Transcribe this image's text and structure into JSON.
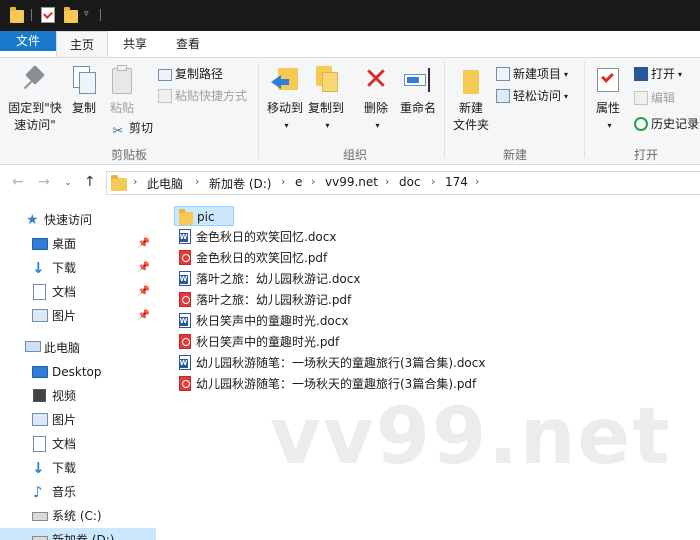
{
  "ribbon_tabs": {
    "file": "文件",
    "home": "主页",
    "share": "共享",
    "view": "查看"
  },
  "clipboard": {
    "pin_quick_access": "固定到\"快速访问\"",
    "copy": "复制",
    "paste": "粘贴",
    "copy_path": "复制路径",
    "paste_shortcut": "粘贴快捷方式",
    "cut": "剪切",
    "group_label": "剪贴板"
  },
  "organize": {
    "move_to": "移动到",
    "copy_to": "复制到",
    "delete": "删除",
    "rename": "重命名",
    "group_label": "组织"
  },
  "new_group": {
    "new_folder_line1": "新建",
    "new_folder_line2": "文件夹",
    "new_item": "新建项目",
    "easy_access": "轻松访问",
    "group_label": "新建"
  },
  "open_group": {
    "properties": "属性",
    "open": "打开",
    "edit": "编辑",
    "history": "历史记录",
    "group_label": "打开"
  },
  "breadcrumb": [
    "此电脑",
    "新加卷 (D:)",
    "e",
    "vv99.net",
    "doc",
    "174"
  ],
  "sidebar": {
    "quick_access": "快速访问",
    "quick_items": [
      "桌面",
      "下载",
      "文档",
      "图片"
    ],
    "this_pc": "此电脑",
    "pc_items": [
      "Desktop",
      "视频",
      "图片",
      "文档",
      "下载",
      "音乐",
      "系统 (C:)",
      "新加卷 (D:)"
    ]
  },
  "files": [
    {
      "name": "pic",
      "type": "folder"
    },
    {
      "name": "金色秋日的欢笑回忆.docx",
      "type": "docx"
    },
    {
      "name": "金色秋日的欢笑回忆.pdf",
      "type": "pdf"
    },
    {
      "name": "落叶之旅：幼儿园秋游记.docx",
      "type": "docx"
    },
    {
      "name": "落叶之旅：幼儿园秋游记.pdf",
      "type": "pdf"
    },
    {
      "name": "秋日笑声中的童趣时光.docx",
      "type": "docx"
    },
    {
      "name": "秋日笑声中的童趣时光.pdf",
      "type": "pdf"
    },
    {
      "name": "幼儿园秋游随笔：一场秋天的童趣旅行(3篇合集).docx",
      "type": "docx"
    },
    {
      "name": "幼儿园秋游随笔：一场秋天的童趣旅行(3篇合集).pdf",
      "type": "pdf"
    }
  ],
  "watermark": "vv99.net",
  "colors": {
    "accent": "#1979ca",
    "selection": "#cce8ff",
    "folder": "#f6c955"
  }
}
